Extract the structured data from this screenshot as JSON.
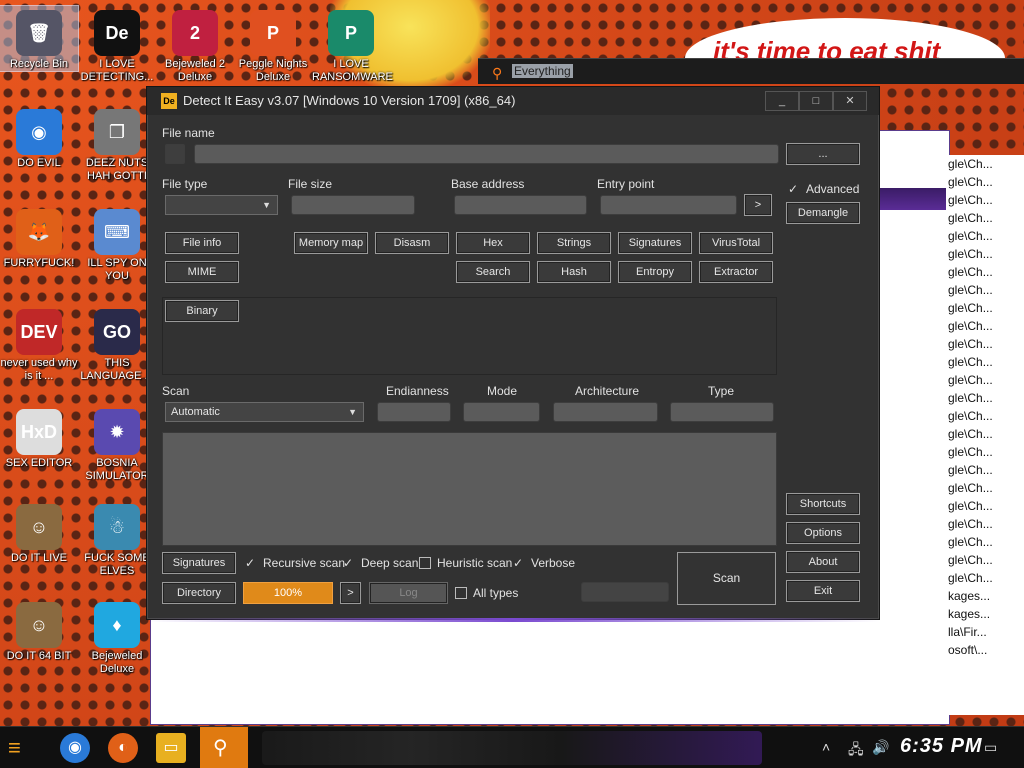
{
  "desktop": {
    "banner_text": "it's time to eat shit",
    "icons": [
      {
        "label": "Recycle Bin",
        "glyph": "🗑",
        "bg": "#556"
      },
      {
        "label": "I LOVE DETECTING...",
        "glyph": "De",
        "bg": "#111"
      },
      {
        "label": "Bejeweled 2 Deluxe",
        "glyph": "2",
        "bg": "#c02040"
      },
      {
        "label": "Peggle Nights Deluxe",
        "glyph": "P",
        "bg": "#e05020"
      },
      {
        "label": "I LOVE RANSOMWARE",
        "glyph": "P",
        "bg": "#1a8a6a"
      },
      {
        "label": "DO EVIL",
        "glyph": "◉",
        "bg": "#2a7ad8"
      },
      {
        "label": "DEEZ NUTS HAH GOTTI",
        "glyph": "❐",
        "bg": "#777"
      },
      {
        "label": "FURRYFUCK!",
        "glyph": "🦊",
        "bg": "#e06018"
      },
      {
        "label": "ILL SPY ON YOU",
        "glyph": "⌨",
        "bg": "#5a8ad0"
      },
      {
        "label": "never used why is it ...",
        "glyph": "DEV",
        "bg": "#c02828"
      },
      {
        "label": "THIS LANGUAGE ...",
        "glyph": "GO",
        "bg": "#2a2a4a"
      },
      {
        "label": "SEX EDITOR",
        "glyph": "HxD",
        "bg": "#ddd"
      },
      {
        "label": "BOSNIA SIMULATOR",
        "glyph": "✹",
        "bg": "#5a4ab0"
      },
      {
        "label": "DO IT LIVE",
        "glyph": "☺",
        "bg": "#8a6a40"
      },
      {
        "label": "FUCK SOME ELVES",
        "glyph": "☃",
        "bg": "#3a8ab0"
      },
      {
        "label": "DO IT 64 BIT",
        "glyph": "☺",
        "bg": "#8a6a40"
      },
      {
        "label": "Bejeweled Deluxe",
        "glyph": "♦",
        "bg": "#20a8e0"
      }
    ]
  },
  "everything": {
    "title": "Everything",
    "list": [
      "gle\\Ch...",
      "gle\\Ch...",
      "gle\\Ch...",
      "gle\\Ch...",
      "gle\\Ch...",
      "gle\\Ch...",
      "gle\\Ch...",
      "gle\\Ch...",
      "gle\\Ch...",
      "gle\\Ch...",
      "gle\\Ch...",
      "gle\\Ch...",
      "gle\\Ch...",
      "gle\\Ch...",
      "gle\\Ch...",
      "gle\\Ch...",
      "gle\\Ch...",
      "gle\\Ch...",
      "gle\\Ch...",
      "gle\\Ch...",
      "gle\\Ch...",
      "gle\\Ch...",
      "gle\\Ch...",
      "gle\\Ch...",
      "kages...",
      "kages...",
      "lla\\Fir...",
      "osoft\\..."
    ]
  },
  "die": {
    "title": "Detect It Easy v3.07 [Windows 10 Version 1709] (x86_64)",
    "app_icon": "De",
    "labels": {
      "file_name": "File name",
      "file_type": "File type",
      "file_size": "File size",
      "base_address": "Base address",
      "entry_point": "Entry point",
      "scan": "Scan",
      "endianness": "Endianness",
      "mode": "Mode",
      "architecture": "Architecture",
      "type": "Type"
    },
    "browse_label": "...",
    "entry_go_label": ">",
    "advanced_label": "Advanced",
    "demangle_label": "Demangle",
    "tools": {
      "file_info": "File info",
      "memory_map": "Memory map",
      "disasm": "Disasm",
      "hex": "Hex",
      "strings": "Strings",
      "signatures": "Signatures",
      "virustotal": "VirusTotal",
      "mime": "MIME",
      "search": "Search",
      "hash": "Hash",
      "entropy": "Entropy",
      "extractor": "Extractor"
    },
    "binary_label": "Binary",
    "scan_mode": "Automatic",
    "side_buttons": {
      "shortcuts": "Shortcuts",
      "options": "Options",
      "about": "About",
      "exit": "Exit"
    },
    "bottom": {
      "signatures": "Signatures",
      "directory": "Directory",
      "recursive_scan": "Recursive scan",
      "deep_scan": "Deep scan",
      "heuristic_scan": "Heuristic scan",
      "verbose": "Verbose",
      "all_types": "All types",
      "progress": "100%",
      "progress_value": 1.0,
      "next": ">",
      "log": "Log",
      "scan": "Scan"
    },
    "window_buttons": {
      "minimize": "_",
      "maximize": "□",
      "close": "✕"
    }
  },
  "taskbar": {
    "clock": "6:35 PM",
    "apps": [
      "Chrome",
      "Firefox",
      "File Explorer",
      "Everything"
    ]
  },
  "colors": {
    "accent_orange": "#e08a1a",
    "die_bg": "#323232",
    "purple": "#7a4ad0"
  }
}
